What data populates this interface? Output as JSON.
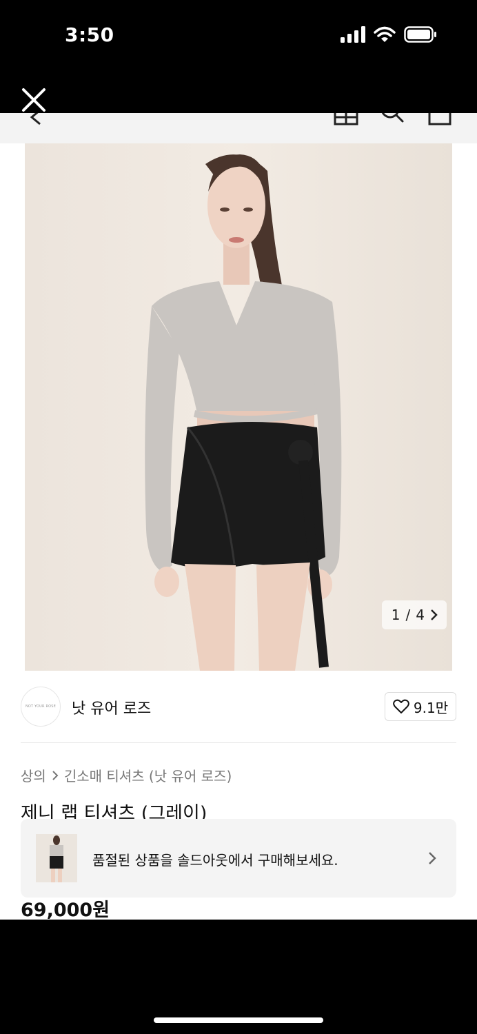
{
  "status_bar": {
    "time": "3:50"
  },
  "product": {
    "image_counter": {
      "current": "1",
      "separator": "/",
      "total": "4"
    },
    "brand": {
      "name": "낫 유어 로즈",
      "logo_text": "NOT YOUR ROSE"
    },
    "likes": "9.1만",
    "breadcrumb": {
      "category": "상의",
      "subcategory": "긴소매 티셔츠 (낫 유어 로즈)"
    },
    "title": "제니 랩 티셔츠 (그레이)",
    "soldout_banner": {
      "text": "품절된 상품을 솔드아웃에서 구매해보세요."
    },
    "price": "69,000원"
  },
  "colors": {
    "background": "#000000",
    "surface": "#ffffff",
    "muted_text": "#777777",
    "banner_bg": "#f4f4f4"
  },
  "icons": [
    "close-icon",
    "back-chevron-icon",
    "home-icon",
    "search-icon",
    "cart-icon",
    "heart-icon",
    "chevron-right-icon",
    "cellular-signal-icon",
    "wifi-icon",
    "battery-icon"
  ]
}
